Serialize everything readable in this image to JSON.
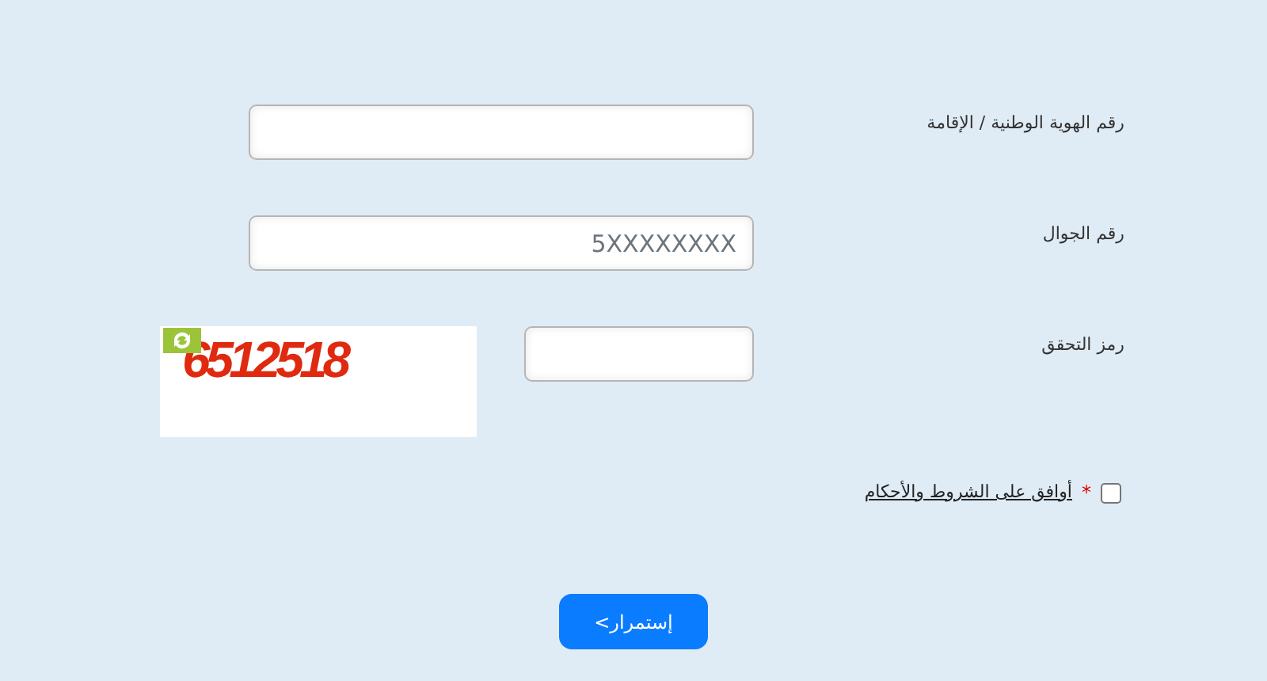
{
  "form": {
    "fields": [
      {
        "kind": "text",
        "label": "رقم الهوية الوطنية / الإقامة"
      },
      {
        "kind": "text",
        "label": "رقم الجوال",
        "placeholder": "5XXXXXXXX"
      },
      {
        "kind": "captcha",
        "label": "رمز التحقق",
        "captcha_code": "6512518"
      }
    ],
    "terms": {
      "checked": false,
      "required_mark": "*",
      "link": "أوافق على الشروط والأحكام"
    },
    "submit": "إستمرار>"
  }
}
